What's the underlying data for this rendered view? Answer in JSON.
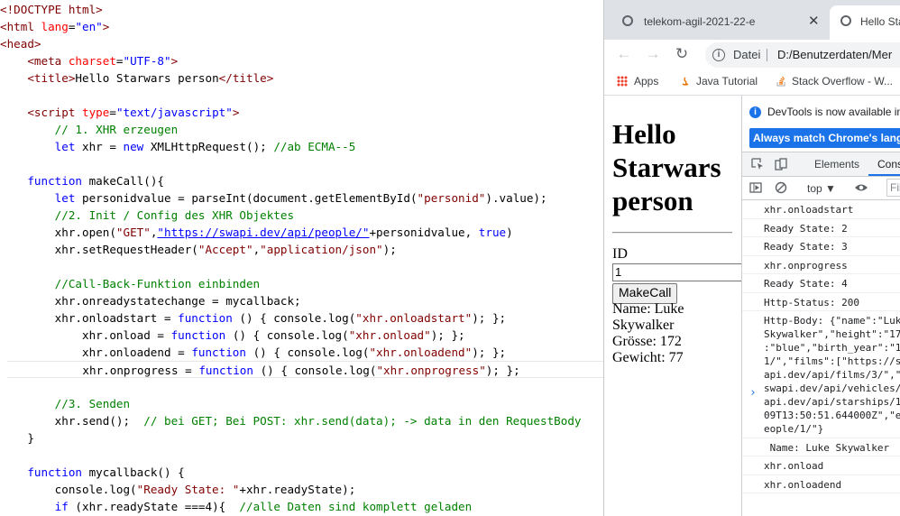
{
  "editor": {
    "lines": [
      [
        [
          "t-tag",
          "<!DOCTYPE html>"
        ]
      ],
      [
        [
          "t-tag",
          "<html "
        ],
        [
          "t-attr",
          "lang"
        ],
        [
          "t-txt",
          "="
        ],
        [
          "t-val",
          "\"en\""
        ],
        [
          "t-tag",
          ">"
        ]
      ],
      [
        [
          "t-tag",
          "<head>"
        ]
      ],
      [
        [
          "t-txt",
          "    "
        ],
        [
          "t-tag",
          "<meta "
        ],
        [
          "t-attr",
          "charset"
        ],
        [
          "t-txt",
          "="
        ],
        [
          "t-val",
          "\"UTF-8\""
        ],
        [
          "t-tag",
          ">"
        ]
      ],
      [
        [
          "t-txt",
          "    "
        ],
        [
          "t-tag",
          "<title>"
        ],
        [
          "t-txt",
          "Hello Starwars person"
        ],
        [
          "t-tag",
          "</title>"
        ]
      ],
      [
        [
          "t-txt",
          ""
        ]
      ],
      [
        [
          "t-txt",
          "    "
        ],
        [
          "t-tag",
          "<script "
        ],
        [
          "t-attr",
          "type"
        ],
        [
          "t-txt",
          "="
        ],
        [
          "t-val",
          "\"text/javascript\""
        ],
        [
          "t-tag",
          ">"
        ]
      ],
      [
        [
          "t-txt",
          "        "
        ],
        [
          "t-cm",
          "// 1. XHR erzeugen"
        ]
      ],
      [
        [
          "t-txt",
          "        "
        ],
        [
          "t-kw",
          "let"
        ],
        [
          "t-txt",
          " xhr = "
        ],
        [
          "t-kw",
          "new"
        ],
        [
          "t-txt",
          " XMLHttpRequest(); "
        ],
        [
          "t-cm",
          "//ab ECMA--5"
        ]
      ],
      [
        [
          "t-txt",
          ""
        ]
      ],
      [
        [
          "t-txt",
          "    "
        ],
        [
          "t-kw",
          "function"
        ],
        [
          "t-txt",
          " makeCall(){"
        ]
      ],
      [
        [
          "t-txt",
          "        "
        ],
        [
          "t-kw",
          "let"
        ],
        [
          "t-txt",
          " personidvalue = parseInt(document.getElementById("
        ],
        [
          "t-str",
          "\"personid\""
        ],
        [
          "t-txt",
          ").value);"
        ]
      ],
      [
        [
          "t-txt",
          "        "
        ],
        [
          "t-cm",
          "//2. Init / Config des XHR Objektes"
        ]
      ],
      [
        [
          "t-txt",
          "        xhr.open("
        ],
        [
          "t-str",
          "\"GET\""
        ],
        [
          "t-txt",
          ","
        ],
        [
          "t-url",
          "\"https://swapi.dev/api/people/\""
        ],
        [
          "t-txt",
          "+personidvalue, "
        ],
        [
          "t-kw",
          "true"
        ],
        [
          "t-txt",
          ")"
        ]
      ],
      [
        [
          "t-txt",
          "        xhr.setRequestHeader("
        ],
        [
          "t-str",
          "\"Accept\""
        ],
        [
          "t-txt",
          ","
        ],
        [
          "t-str",
          "\"application/json\""
        ],
        [
          "t-txt",
          ");"
        ]
      ],
      [
        [
          "t-txt",
          ""
        ]
      ],
      [
        [
          "t-txt",
          "        "
        ],
        [
          "t-cm",
          "//Call-Back-Funktion einbinden"
        ]
      ],
      [
        [
          "t-txt",
          "        xhr.onreadystatechange = mycallback;"
        ]
      ],
      [
        [
          "t-txt",
          "        xhr.onloadstart = "
        ],
        [
          "t-kw",
          "function"
        ],
        [
          "t-txt",
          " () { console.log("
        ],
        [
          "t-str",
          "\"xhr.onloadstart\""
        ],
        [
          "t-txt",
          "); };"
        ]
      ],
      [
        [
          "t-txt",
          "            xhr.onload = "
        ],
        [
          "t-kw",
          "function"
        ],
        [
          "t-txt",
          " () { console.log("
        ],
        [
          "t-str",
          "\"xhr.onload\""
        ],
        [
          "t-txt",
          "); };"
        ]
      ],
      [
        [
          "t-txt",
          "            xhr.onloadend = "
        ],
        [
          "t-kw",
          "function"
        ],
        [
          "t-txt",
          " () { console.log("
        ],
        [
          "t-str",
          "\"xhr.onloadend\""
        ],
        [
          "t-txt",
          "); };"
        ]
      ],
      [
        [
          "t-txt",
          "            xhr.onprogress = "
        ],
        [
          "t-kw",
          "function"
        ],
        [
          "t-txt",
          " () { console.log("
        ],
        [
          "t-str",
          "\"xhr.onprogress\""
        ],
        [
          "t-txt",
          "); };"
        ]
      ],
      [
        [
          "t-txt",
          ""
        ]
      ],
      [
        [
          "t-txt",
          "        "
        ],
        [
          "t-cm",
          "//3. Senden"
        ]
      ],
      [
        [
          "t-txt",
          "        xhr.send();  "
        ],
        [
          "t-cm",
          "// bei GET; Bei POST: xhr.send(data); -> data in den RequestBody"
        ]
      ],
      [
        [
          "t-txt",
          "    }"
        ]
      ],
      [
        [
          "t-txt",
          ""
        ]
      ],
      [
        [
          "t-txt",
          "    "
        ],
        [
          "t-kw",
          "function"
        ],
        [
          "t-txt",
          " mycallback() {"
        ]
      ],
      [
        [
          "t-txt",
          "        console.log("
        ],
        [
          "t-str",
          "\"Ready State: \""
        ],
        [
          "t-txt",
          "+xhr.readyState);"
        ]
      ],
      [
        [
          "t-txt",
          "        "
        ],
        [
          "t-kw",
          "if"
        ],
        [
          "t-txt",
          " (xhr.readyState ===4){  "
        ],
        [
          "t-cm",
          "//alle Daten sind komplett geladen"
        ]
      ]
    ]
  },
  "browser": {
    "tabs": [
      {
        "label": "telekom-agil-2021-22-e",
        "close": "✕"
      },
      {
        "label": "Hello Sta"
      }
    ],
    "nav": {
      "back": "←",
      "forward": "→",
      "reload": "↻"
    },
    "omnibox": {
      "scheme": "Datei",
      "path": "D:/Benutzerdaten/Mer"
    },
    "bookmarks": [
      {
        "label": "Apps",
        "icon": "apps-grid-icon"
      },
      {
        "label": "Java Tutorial",
        "icon": "java-icon"
      },
      {
        "label": "Stack Overflow - W...",
        "icon": "stackoverflow-icon"
      }
    ]
  },
  "page": {
    "heading_lines": [
      "Hello",
      "Starwars",
      "person"
    ],
    "id_label": "ID",
    "id_value": "1",
    "button_label": "MakeCall",
    "results": [
      "Name: Luke",
      "Skywalker",
      "Grösse: 172",
      "Gewicht: 77"
    ]
  },
  "devtools": {
    "info_message": "DevTools is now available in",
    "info_button": "Always match Chrome's langua",
    "tabs": {
      "elements": "Elements",
      "console": "Cons"
    },
    "context": "top",
    "filter_placeholder": "Filt",
    "prompt": "›",
    "logs": [
      {
        "text": "xhr.onloadstart",
        "h": 1
      },
      {
        "text": "Ready State: 2",
        "h": 1
      },
      {
        "text": "Ready State: 3",
        "h": 1
      },
      {
        "text": "xhr.onprogress",
        "h": 1
      },
      {
        "text": "Ready State: 4",
        "h": 1
      },
      {
        "text": "Http-Status: 200",
        "h": 1
      },
      {
        "text": "Http-Body: {\"name\":\"Luke\nSkywalker\",\"height\":\"17\n:\"blue\",\"birth_year\":\"19\n1/\",\"films\":[\"https://s\napi.dev/api/films/3/\",\"\nswapi.dev/api/vehicles/\napi.dev/api/starships/1\n09T13:50:51.644000Z\",\"e\neople/1/\"}",
        "h": 9
      },
      {
        "text": " Name: Luke Skywalker",
        "h": 1
      },
      {
        "text": "xhr.onload",
        "h": 1
      },
      {
        "text": "xhr.onloadend",
        "h": 1
      }
    ]
  }
}
